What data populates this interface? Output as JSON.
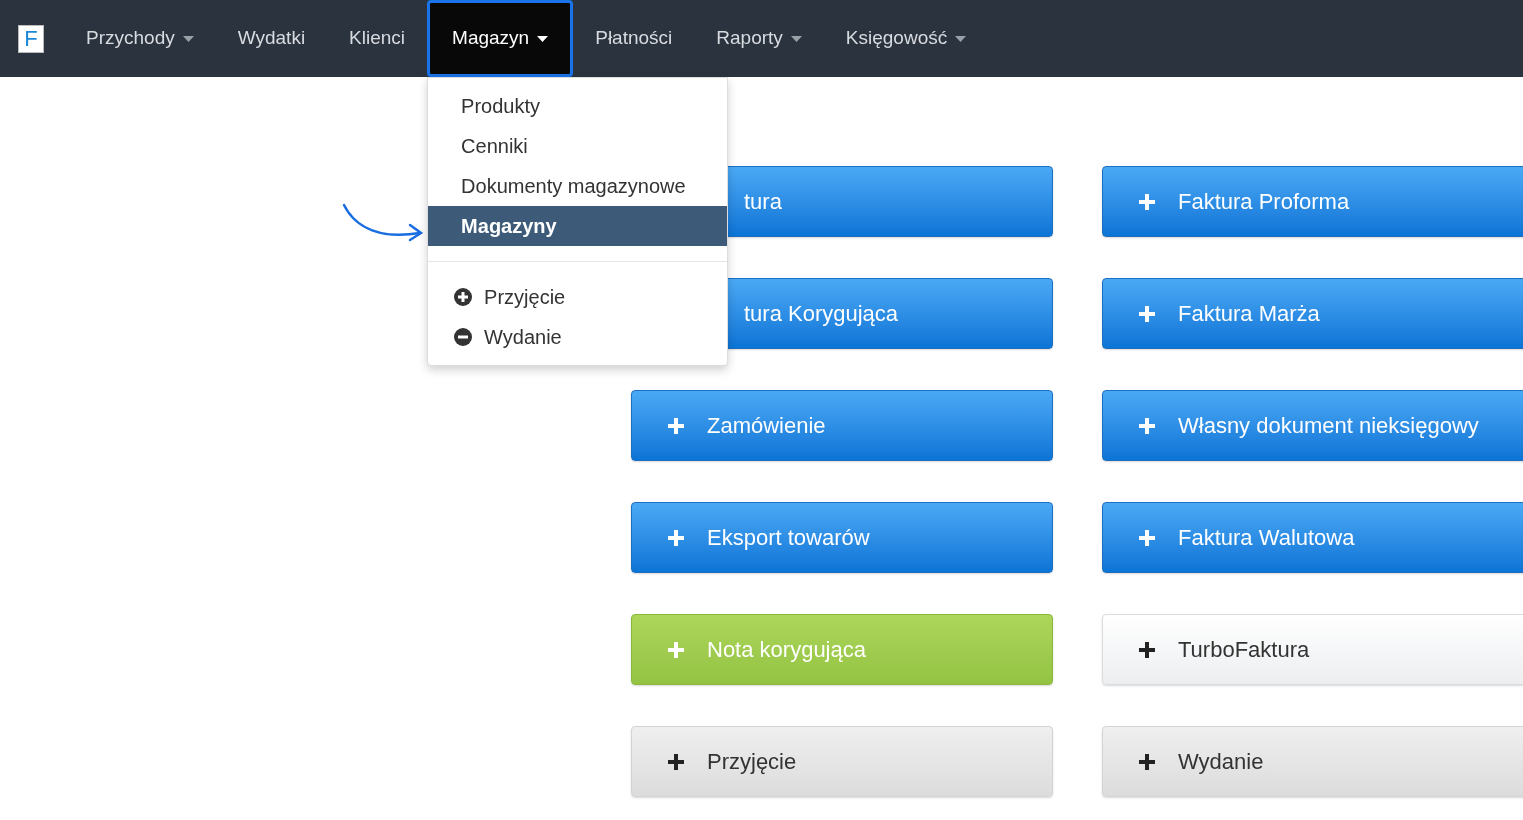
{
  "navbar": {
    "logo": "F",
    "items": [
      {
        "label": "Przychody",
        "dropdown": true,
        "selected": false
      },
      {
        "label": "Wydatki",
        "dropdown": false,
        "selected": false
      },
      {
        "label": "Klienci",
        "dropdown": false,
        "selected": false
      },
      {
        "label": "Magazyn",
        "dropdown": true,
        "selected": true
      },
      {
        "label": "Płatności",
        "dropdown": false,
        "selected": false
      },
      {
        "label": "Raporty",
        "dropdown": true,
        "selected": false
      },
      {
        "label": "Księgowość",
        "dropdown": true,
        "selected": false
      }
    ]
  },
  "dropdown_menu": {
    "items": [
      {
        "kind": "link",
        "label": "Produkty",
        "selected": false
      },
      {
        "kind": "link",
        "label": "Cenniki",
        "selected": false
      },
      {
        "kind": "link",
        "label": "Dokumenty magazynowe",
        "selected": false
      },
      {
        "kind": "link",
        "label": "Magazyny",
        "selected": true
      },
      {
        "kind": "divider"
      },
      {
        "kind": "plus",
        "label": "Przyjęcie",
        "selected": false
      },
      {
        "kind": "minus",
        "label": "Wydanie",
        "selected": false
      }
    ]
  },
  "buttons": [
    {
      "kind": "primary",
      "label": "tura",
      "covered": true
    },
    {
      "kind": "primary",
      "label": "Faktura Proforma",
      "covered": false
    },
    {
      "kind": "primary",
      "label": "tura Korygująca",
      "covered": true
    },
    {
      "kind": "primary",
      "label": "Faktura Marża",
      "covered": false
    },
    {
      "kind": "primary",
      "label": "Zamówienie",
      "covered": false
    },
    {
      "kind": "primary",
      "label": "Własny dokument nieksięgowy",
      "covered": false
    },
    {
      "kind": "primary",
      "label": "Eksport towarów",
      "covered": false
    },
    {
      "kind": "primary",
      "label": "Faktura Walutowa",
      "covered": false
    },
    {
      "kind": "success",
      "label": "Nota korygująca",
      "covered": false
    },
    {
      "kind": "default",
      "label": "TurboFaktura",
      "covered": false
    },
    {
      "kind": "light",
      "label": "Przyjęcie",
      "covered": false
    },
    {
      "kind": "light",
      "label": "Wydanie",
      "covered": false
    }
  ]
}
